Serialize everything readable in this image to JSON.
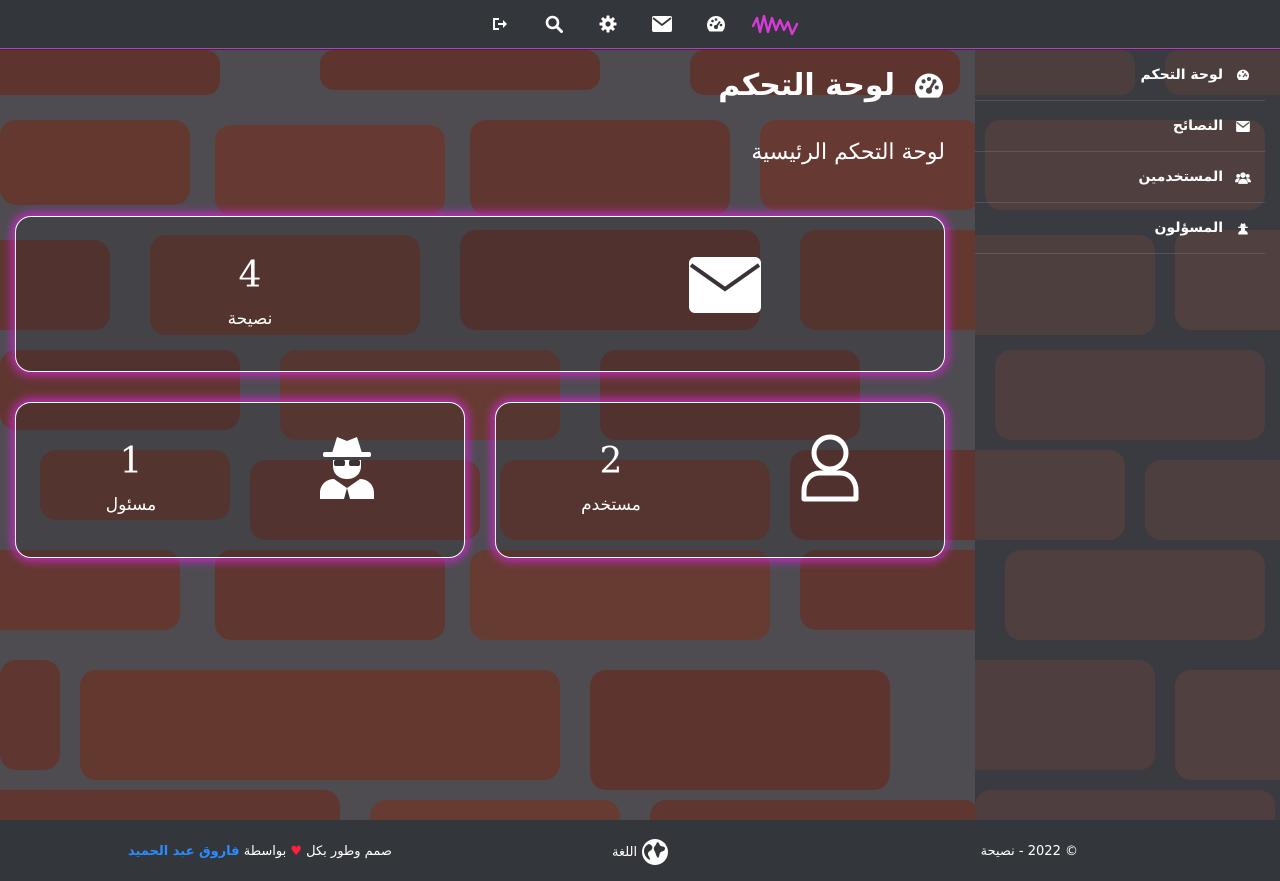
{
  "topbar": {
    "icons": [
      "logout-icon",
      "search-icon",
      "gear-icon",
      "envelope-icon",
      "dashboard-icon",
      "brand-wave-logo"
    ],
    "accent_color": "#c735c7"
  },
  "sidebar": {
    "items": [
      {
        "label": "لوحة التحكم",
        "icon": "dashboard-icon"
      },
      {
        "label": "النصائح",
        "icon": "envelope-icon"
      },
      {
        "label": "المستخدمين",
        "icon": "users-icon"
      },
      {
        "label": "المسؤلون",
        "icon": "user-secret-icon"
      }
    ]
  },
  "main": {
    "title": "لوحة التحكم",
    "subtitle": "لوحة التحكم الرئيسية",
    "cards": {
      "tips": {
        "count": "4",
        "label": "نصيحة",
        "icon": "envelope-icon"
      },
      "users": {
        "count": "2",
        "label": "مستخدم",
        "icon": "user-icon"
      },
      "admins": {
        "count": "1",
        "label": "مسئول",
        "icon": "user-secret-icon"
      }
    },
    "glow_color": "#d228d2"
  },
  "footer": {
    "copyright": "© 2022 - نصيحة",
    "language_label": "اللغة",
    "credit_prefix": "صمم وطور بكل",
    "credit_heart": "♥",
    "credit_by": "بواسطة",
    "credit_author": "فاروق عبد الحميد",
    "author_color": "#2b8cff"
  }
}
